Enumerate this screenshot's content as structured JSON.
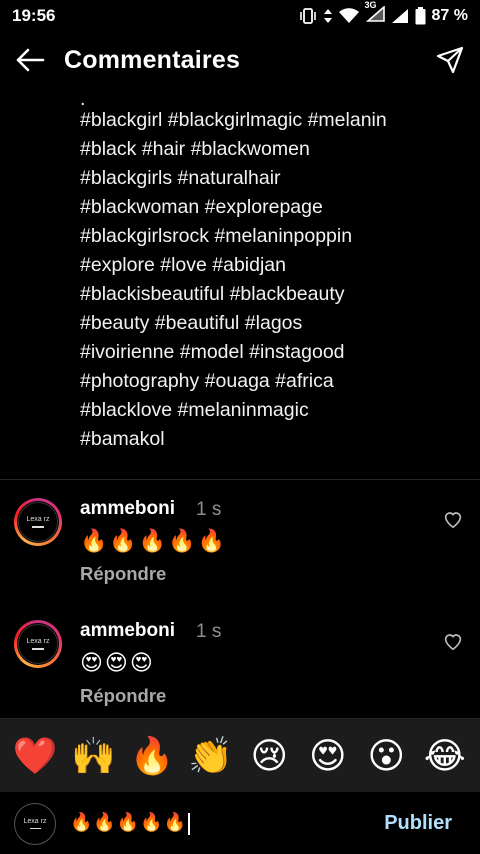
{
  "status": {
    "time": "19:56",
    "network": "3G",
    "battery": "87 %",
    "icons": [
      "vibrate-icon",
      "data-arrows-icon",
      "wifi-icon",
      "signal-icon",
      "battery-icon"
    ]
  },
  "header": {
    "title": "Commentaires",
    "back_icon": "arrow-left-icon",
    "share_icon": "paper-plane-icon"
  },
  "caption": {
    "lines": [
      ".",
      "#blackgirl #blackgirlmagic #melanin",
      "#black #hair #blackwomen",
      "#blackgirls #naturalhair",
      "#blackwoman #explorepage",
      "#blackgirlsrock #melaninpoppin",
      "#explore #love #abidjan",
      "#blackisbeautiful #blackbeauty",
      "#beauty #beautiful #lagos",
      "#ivoirienne #model #instagood",
      "#photography #ouaga #africa",
      "#blacklove #melaninmagic",
      "#bamakol"
    ]
  },
  "comments": [
    {
      "user": "ammeboni",
      "time": "1 s",
      "text": "🔥🔥🔥🔥🔥",
      "reply": "Répondre",
      "avatar_text": "Lexa rz"
    },
    {
      "user": "ammeboni",
      "time": "1 s",
      "text": "😍😍😍",
      "reply": "Répondre",
      "avatar_text": "Lexa rz"
    }
  ],
  "emoji_bar": [
    "❤️",
    "🙌",
    "🔥",
    "👏",
    "😢",
    "😍",
    "😮",
    "😂"
  ],
  "compose": {
    "value": "🔥🔥🔥🔥🔥",
    "publish_label": "Publier",
    "avatar_text": "Lexa rz"
  },
  "colors": {
    "background": "#000000",
    "emoji_bar_bg": "#1c1c1c",
    "publish": "#b2dffc",
    "muted": "#8e8e8e"
  }
}
